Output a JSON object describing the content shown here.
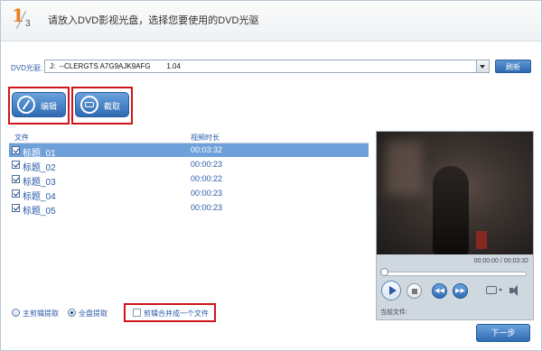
{
  "header": {
    "step_current": "1",
    "step_total": "3",
    "title": "请放入DVD影视光盘，选择您要使用的DVD光驱"
  },
  "dvd": {
    "label": "DVD光驱:",
    "selected_value": "J:  --CLERGTS A7G9AJK9AFG        1.04",
    "refresh_label": "刷新"
  },
  "tools": {
    "edit_label": "编辑",
    "capture_label": "截取"
  },
  "file_list": {
    "col_file": "文件",
    "col_duration": "视频时长",
    "rows": [
      {
        "name": "标题_01",
        "duration": "00:03:32",
        "selected": true,
        "checked": true
      },
      {
        "name": "标题_02",
        "duration": "00:00:23",
        "selected": false,
        "checked": true
      },
      {
        "name": "标题_03",
        "duration": "00:00:22",
        "selected": false,
        "checked": true
      },
      {
        "name": "标题_04",
        "duration": "00:00:23",
        "selected": false,
        "checked": true
      },
      {
        "name": "标题_05",
        "duration": "00:00:23",
        "selected": false,
        "checked": true
      }
    ]
  },
  "player": {
    "time_display": "00:00:00 / 00:03:32",
    "current_file_label": "当前文件:",
    "progress": 0
  },
  "options": {
    "main_title_label": "主剪辑提取",
    "full_extract_label": "全盘提取",
    "full_extract_selected": true,
    "merge_label": "剪辑合并成一个文件",
    "merge_checked": false
  },
  "next_label": "下一步",
  "colors": {
    "accent": "#2f6bb3",
    "highlight_border": "#d0141b",
    "step_orange": "#f07b1a",
    "selected_row": "#6ea0da"
  }
}
